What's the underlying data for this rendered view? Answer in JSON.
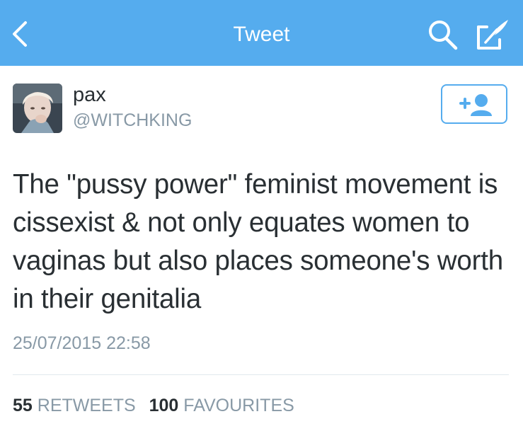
{
  "header": {
    "title": "Tweet",
    "back_icon": "chevron-left-icon",
    "search_icon": "search-icon",
    "compose_icon": "compose-tweet-icon",
    "background_color": "#55acee"
  },
  "user": {
    "name": "pax",
    "handle": "@WITCHKING",
    "avatar_icon": "user-avatar",
    "follow_icon": "follow-user-icon"
  },
  "tweet": {
    "text": "The \"pussy power\" feminist movement is cissexist & not only equates women to vaginas but also places someone's worth in their genitalia",
    "timestamp": "25/07/2015 22:58"
  },
  "stats": {
    "retweets_count": "55",
    "retweets_label": "RETWEETS",
    "favourites_count": "100",
    "favourites_label": "FAVOURITES"
  },
  "colors": {
    "accent": "#55acee",
    "text": "#292f33",
    "muted": "#8899a6",
    "divider": "#e1e8ed"
  }
}
